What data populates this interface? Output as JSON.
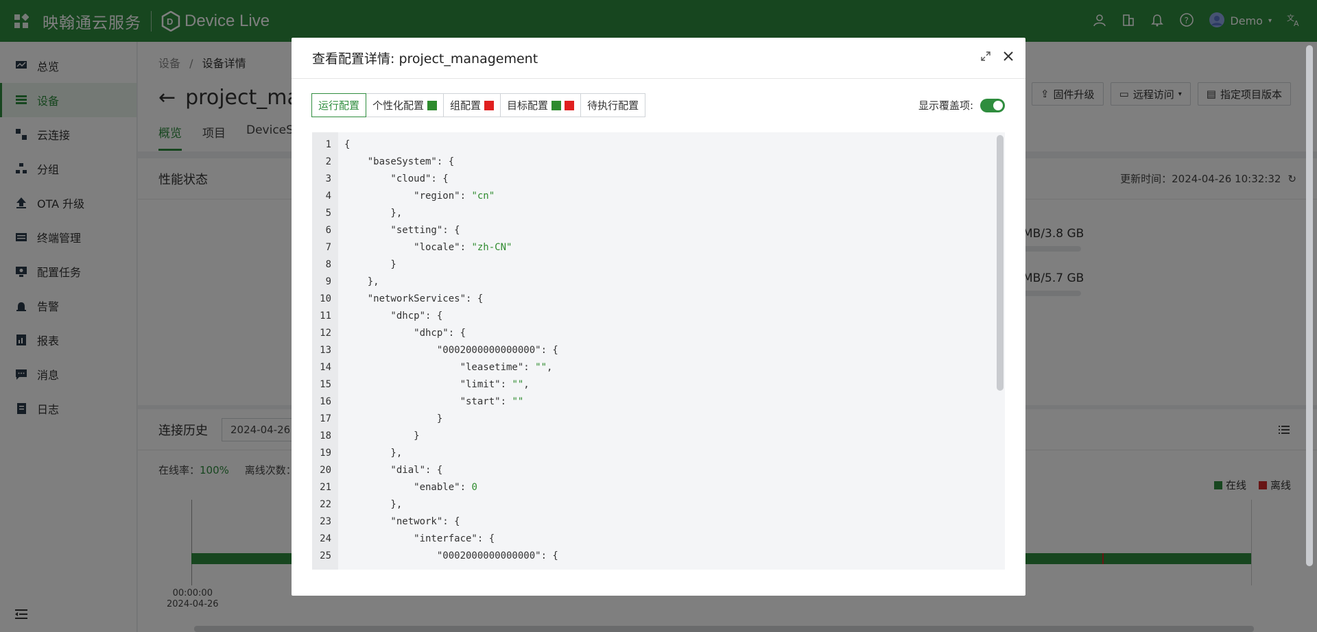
{
  "topbar": {
    "brand": "映翰通云服务",
    "logo_text": "Device Live",
    "user": "Demo"
  },
  "sidebar": {
    "items": [
      {
        "label": "总览",
        "icon": "dashboard-icon"
      },
      {
        "label": "设备",
        "icon": "device-list-icon"
      },
      {
        "label": "云连接",
        "icon": "cloud-connect-icon"
      },
      {
        "label": "分组",
        "icon": "group-tree-icon"
      },
      {
        "label": "OTA 升级",
        "icon": "upload-icon"
      },
      {
        "label": "终端管理",
        "icon": "keyboard-icon"
      },
      {
        "label": "配置任务",
        "icon": "monitor-config-icon"
      },
      {
        "label": "告警",
        "icon": "alarm-icon"
      },
      {
        "label": "报表",
        "icon": "report-icon"
      },
      {
        "label": "消息",
        "icon": "message-icon"
      },
      {
        "label": "日志",
        "icon": "log-icon"
      }
    ]
  },
  "breadcrumb": {
    "root": "设备",
    "sep": "/",
    "current": "设备详情"
  },
  "page": {
    "title": "project_man",
    "tabs": [
      "概览",
      "项目",
      "DeviceSu"
    ]
  },
  "actions": {
    "firmware": "固件升级",
    "remote": "远程访问",
    "version": "指定项目版本"
  },
  "perf": {
    "title": "性能状态",
    "update_label": "更新时间：2024-04-26 10:32:32",
    "mem1": "MB/3.8 GB",
    "mem2": "MB/5.7 GB"
  },
  "history": {
    "title": "连接历史",
    "date": "2024-04-26",
    "rate_label": "在线率：",
    "rate_value": "100%",
    "offline_label": "离线次数：",
    "legend_online": "在线",
    "legend_offline": "离线",
    "time": "00:00:00",
    "time_date": "2024-04-26"
  },
  "modal": {
    "title": "查看配置详情: project_management",
    "tabs": [
      "运行配置",
      "个性化配置",
      "组配置",
      "目标配置",
      "待执行配置"
    ],
    "toggle_label": "显示覆盖项:",
    "toggle_on": true,
    "colors": {
      "green": "#2e8b2e",
      "red": "#e02020"
    }
  },
  "code": {
    "line_numbers": [
      "1",
      "2",
      "3",
      "4",
      "5",
      "6",
      "7",
      "8",
      "9",
      "10",
      "11",
      "12",
      "13",
      "14",
      "15",
      "16",
      "17",
      "18",
      "19",
      "20",
      "21",
      "22",
      "23",
      "24",
      "25"
    ],
    "lines": [
      [
        [
          "{",
          ""
        ]
      ],
      [
        [
          "    \"baseSystem\": {",
          ""
        ]
      ],
      [
        [
          "        \"cloud\": {",
          ""
        ]
      ],
      [
        [
          "            \"region\": ",
          ""
        ],
        [
          "\"cn\"",
          "s"
        ]
      ],
      [
        [
          "        },",
          ""
        ]
      ],
      [
        [
          "        \"setting\": {",
          ""
        ]
      ],
      [
        [
          "            \"locale\": ",
          ""
        ],
        [
          "\"zh-CN\"",
          "s"
        ]
      ],
      [
        [
          "        }",
          ""
        ]
      ],
      [
        [
          "    },",
          ""
        ]
      ],
      [
        [
          "    \"networkServices\": {",
          ""
        ]
      ],
      [
        [
          "        \"dhcp\": {",
          ""
        ]
      ],
      [
        [
          "            \"dhcp\": {",
          ""
        ]
      ],
      [
        [
          "                \"0002000000000000\": {",
          ""
        ]
      ],
      [
        [
          "                    \"leasetime\": ",
          ""
        ],
        [
          "\"\"",
          "s"
        ],
        [
          ",",
          ""
        ]
      ],
      [
        [
          "                    \"limit\": ",
          ""
        ],
        [
          "\"\"",
          "s"
        ],
        [
          ",",
          ""
        ]
      ],
      [
        [
          "                    \"start\": ",
          ""
        ],
        [
          "\"\"",
          "s"
        ]
      ],
      [
        [
          "                }",
          ""
        ]
      ],
      [
        [
          "            }",
          ""
        ]
      ],
      [
        [
          "        },",
          ""
        ]
      ],
      [
        [
          "        \"dial\": {",
          ""
        ]
      ],
      [
        [
          "            \"enable\": ",
          ""
        ],
        [
          "0",
          "n"
        ]
      ],
      [
        [
          "        },",
          ""
        ]
      ],
      [
        [
          "        \"network\": {",
          ""
        ]
      ],
      [
        [
          "            \"interface\": {",
          ""
        ]
      ],
      [
        [
          "                \"0002000000000000\": {",
          ""
        ]
      ]
    ]
  }
}
